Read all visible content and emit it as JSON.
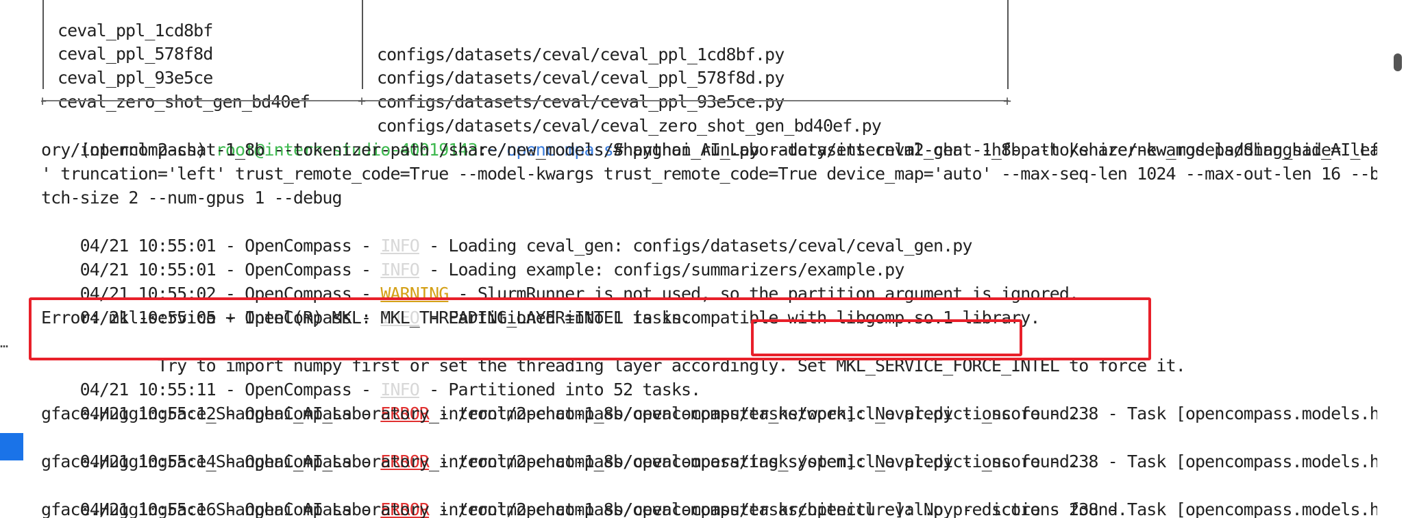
{
  "table": {
    "rows": [
      {
        "name": "ceval_ppl_1cd8bf",
        "path": "configs/datasets/ceval/ceval_ppl_1cd8bf.py"
      },
      {
        "name": "ceval_ppl_578f8d",
        "path": "configs/datasets/ceval/ceval_ppl_578f8d.py"
      },
      {
        "name": "ceval_ppl_93e5ce",
        "path": "configs/datasets/ceval/ceval_ppl_93e5ce.py"
      },
      {
        "name": "ceval_zero_shot_gen_bd40ef",
        "path": "configs/datasets/ceval/ceval_zero_shot_gen_bd40ef.py"
      }
    ]
  },
  "prompt": {
    "env": "(opencompass) ",
    "user_host": "root@intern-studio-40019143",
    "sep": ":",
    "cwd": "~/opencompass",
    "symbol": "# ",
    "cmd1": "python run.py --datasets ceval_gen --hf-path /share/new_models/Shanghai_AI_Laborat",
    "cmd2": "ory/internlm2-chat-1_8b --tokenizer-path /share/new_models/Shanghai_AI_Laboratory/internlm2-chat-1_8b --tokenizer-kwargs padding_side='left",
    "cmd3": "' truncation='left' trust_remote_code=True --model-kwargs trust_remote_code=True device_map='auto' --max-seq-len 1024 --max-out-len 16 --ba",
    "cmd4": "tch-size 2 --num-gpus 1 --debug"
  },
  "logs": [
    {
      "prefix": "04/21 10:55:01 - OpenCompass - ",
      "level": "INFO",
      "msg": " - Loading ceval_gen: configs/datasets/ceval/ceval_gen.py"
    },
    {
      "prefix": "04/21 10:55:01 - OpenCompass - ",
      "level": "INFO",
      "msg": " - Loading example: configs/summarizers/example.py"
    },
    {
      "prefix": "04/21 10:55:02 - OpenCompass - ",
      "level": "WARNING",
      "msg": " - SlurmRunner is not used, so the partition argument is ignored."
    },
    {
      "prefix": "04/21 10:55:05 - OpenCompass - ",
      "level": "INFO",
      "msg": " - Partitioned into 1 tasks."
    },
    {
      "prefix": "04/21 10:55:11 - OpenCompass - ",
      "level": "INFO",
      "msg": " - Partitioned into 52 tasks."
    },
    {
      "prefix": "04/21 10:55:12 - OpenCompass - ",
      "level": "ERROR",
      "msg": " - /root/opencompass/opencompass/tasks/openicl_eval.py - _score - 238 - Task [opencompass.models.huggin",
      "cont": "gface.HuggingFace_Shanghai_AI_Laboratory_internlm2-chat-1_8b/ceval-computer_network]: No predictions found."
    },
    {
      "prefix": "04/21 10:55:14 - OpenCompass - ",
      "level": "ERROR",
      "msg": " - /root/opencompass/opencompass/tasks/openicl_eval.py - _score - 238 - Task [opencompass.models.huggin",
      "cont": "gface.HuggingFace_Shanghai_AI_Laboratory_internlm2-chat-1_8b/ceval-operating_system]: No predictions found."
    },
    {
      "prefix": "04/21 10:55:16 - OpenCompass - ",
      "level": "ERROR",
      "msg": " - /root/opencompass/opencompass/tasks/openicl_eval.py - _score - 238 - Task [opencompass.models.huggin",
      "cont": "gface.HuggingFace_Shanghai_AI_Laboratory_internlm2-chat-1_8b/ceval-computer_architecture]: No predictions found."
    }
  ],
  "error": {
    "line1": "Error: mkl-service + Intel(R) MKL: MKL_THREADING_LAYER=INTEL is incompatible with libgomp.so.1 library.",
    "line2a": "        Try to import numpy first or set the threading layer accordingly. ",
    "line2b": "Set MKL_SERVICE_FORCE_INTEL",
    "line2c": " to force it."
  },
  "colors": {
    "highlight_box": "#e8202a",
    "info": "#d8d8d8",
    "warning": "#d4a017",
    "error": "#e03030",
    "prompt_user": "#3fb950",
    "prompt_path": "#3b7ddd"
  }
}
